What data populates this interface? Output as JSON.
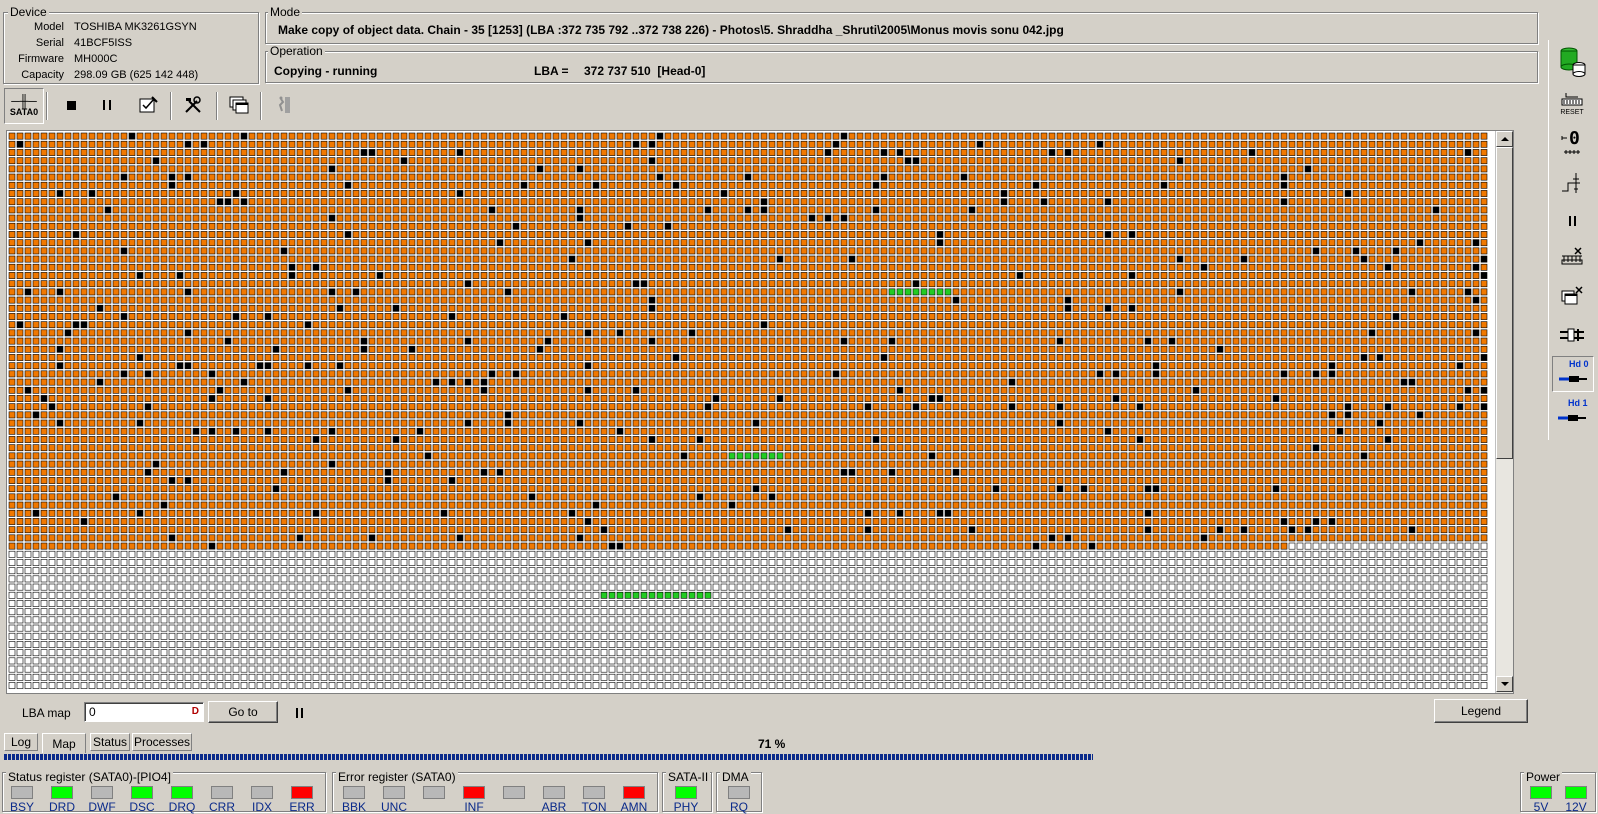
{
  "device": {
    "legend": "Device",
    "fields": [
      {
        "label": "Model",
        "value": "TOSHIBA MK3261GSYN"
      },
      {
        "label": "Serial",
        "value": "41BCF5ISS"
      },
      {
        "label": "Firmware",
        "value": "MH000C"
      },
      {
        "label": "Capacity",
        "value": "298.09 GB (625 142 448)"
      }
    ]
  },
  "mode": {
    "legend": "Mode",
    "text": "Make copy of object data. Chain - 35 [1253] (LBA :372 735 792 ..372 738 226) - Photos\\5. Shraddha _Shruti\\2005\\Monus movis sonu 042.jpg"
  },
  "operation": {
    "legend": "Operation",
    "status": "Copying - running",
    "lba_label": "LBA =",
    "lba_value": "372 737 510  [Head-0]"
  },
  "toolbar": {
    "port_label": "SATA0"
  },
  "map_controls": {
    "lba_map_label": "LBA map",
    "lba_input_value": "0",
    "input_suffix": "D",
    "goto_label": "Go to",
    "legend_label": "Legend"
  },
  "tabs": [
    {
      "label": "Log"
    },
    {
      "label": "Map"
    },
    {
      "label": "Status"
    },
    {
      "label": "Processes"
    }
  ],
  "progress": {
    "percent_text": "71 %",
    "fraction": 0.71
  },
  "status_register": {
    "legend": "Status register (SATA0)-[PIO4]",
    "leds": [
      {
        "label": "BSY",
        "color": "#b8b8b8"
      },
      {
        "label": "DRD",
        "color": "#00ff00"
      },
      {
        "label": "DWF",
        "color": "#b8b8b8"
      },
      {
        "label": "DSC",
        "color": "#00ff00"
      },
      {
        "label": "DRQ",
        "color": "#00ff00"
      },
      {
        "label": "CRR",
        "color": "#b8b8b8"
      },
      {
        "label": "IDX",
        "color": "#b8b8b8"
      },
      {
        "label": "ERR",
        "color": "#ff0000"
      }
    ]
  },
  "error_register": {
    "legend": "Error register (SATA0)",
    "leds": [
      {
        "label": "BBK",
        "color": "#b8b8b8"
      },
      {
        "label": "UNC",
        "color": "#b8b8b8"
      },
      {
        "label": "",
        "color": "#b8b8b8"
      },
      {
        "label": "INF",
        "color": "#ff0000"
      },
      {
        "label": "",
        "color": "#b8b8b8"
      },
      {
        "label": "ABR",
        "color": "#b8b8b8"
      },
      {
        "label": "TON",
        "color": "#b8b8b8"
      },
      {
        "label": "AMN",
        "color": "#ff0000"
      }
    ]
  },
  "sata": {
    "legend": "SATA-II",
    "led_label": "PHY",
    "color": "#00ff00"
  },
  "dma": {
    "legend": "DMA",
    "led_label": "RQ",
    "color": "#b8b8b8"
  },
  "power": {
    "legend": "Power",
    "leds": [
      {
        "label": "5V",
        "color": "#00ff00"
      },
      {
        "label": "12V",
        "color": "#00ff00"
      }
    ]
  },
  "side_toolbar": {
    "reset_label": "RESET",
    "head0_label": "Hd 0",
    "head1_label": "Hd 1"
  },
  "colors": {
    "read_ok": "#f07800",
    "bad_block": "#000000",
    "current": "#22cc22",
    "unread": "#ffffff",
    "progress": "#0a2a8a"
  }
}
